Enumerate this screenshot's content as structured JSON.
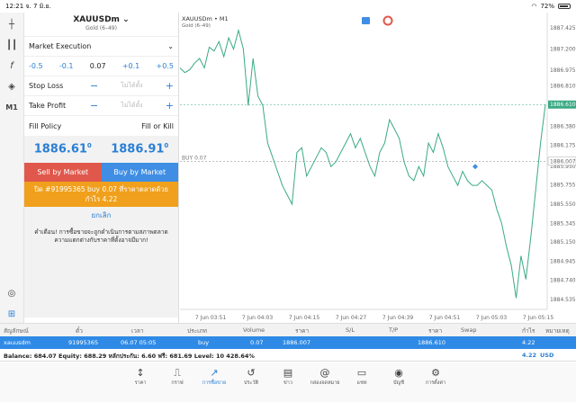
{
  "status": {
    "time": "12:21",
    "date": "จ. 7 มิ.ย.",
    "battery": "72%"
  },
  "panel": {
    "symbol": "XAUUSDm",
    "symbol_desc": "Gold (6–49)",
    "execution": "Market Execution",
    "vol_steps": [
      "-0.5",
      "-0.1",
      "0.07",
      "+0.1",
      "+0.5"
    ],
    "stop_loss": "Stop Loss",
    "take_profit": "Take Profit",
    "not_set": "ไม่ได้ตั้ง",
    "fill_policy": "Fill Policy",
    "fill_value": "Fill or Kill",
    "bid_main": "1886.61",
    "bid_small": "0",
    "ask_main": "1886.91",
    "ask_small": "0",
    "sell_label": "Sell by Market",
    "buy_label": "Buy by Market",
    "close_line1": "ปิด #91995365 buy 0.07 ที่ราคาตลาดด้วย",
    "close_line2": "กำไร 4.22",
    "cancel": "ยกเลิก",
    "warning": "คำเตือน! การซื้อขายจะถูกดำเนินการตามสภาพตลาด ความแตกต่างกับราคาที่ตั้งอาจมีมาก!"
  },
  "chart_header": {
    "symbol_tf": "XAUUSDm • M1",
    "desc": "Gold (6–49)",
    "buy_label": "BUY 0.07",
    "current_price": "1886.610",
    "buy_price": "1886.007"
  },
  "chart_data": {
    "type": "line",
    "y_ticks": [
      "1887.425",
      "1887.200",
      "1886.975",
      "1886.810",
      "1886.605",
      "1886.380",
      "1886.175",
      "1885.950",
      "1885.755",
      "1885.550",
      "1885.345",
      "1885.150",
      "1884.945",
      "1884.740",
      "1884.535"
    ],
    "x_ticks": [
      "7 Jun 03:51",
      "7 Jun 04:03",
      "7 Jun 04:15",
      "7 Jun 04:27",
      "7 Jun 04:39",
      "7 Jun 04:51",
      "7 Jun 05:03",
      "7 Jun 05:15"
    ],
    "ylim": [
      1884.45,
      1887.55
    ],
    "values": [
      1887.0,
      1886.95,
      1886.98,
      1887.05,
      1887.1,
      1887.0,
      1887.22,
      1887.18,
      1887.28,
      1887.12,
      1887.32,
      1887.2,
      1887.4,
      1887.2,
      1886.6,
      1887.1,
      1886.7,
      1886.6,
      1886.2,
      1886.05,
      1885.9,
      1885.75,
      1885.65,
      1885.55,
      1886.1,
      1886.15,
      1885.85,
      1885.95,
      1886.05,
      1886.15,
      1886.1,
      1885.95,
      1886.0,
      1886.1,
      1886.2,
      1886.3,
      1886.15,
      1886.25,
      1886.1,
      1885.95,
      1885.85,
      1886.1,
      1886.2,
      1886.45,
      1886.35,
      1886.25,
      1886.0,
      1885.85,
      1885.8,
      1885.95,
      1885.85,
      1886.2,
      1886.1,
      1886.3,
      1886.15,
      1885.95,
      1885.85,
      1885.75,
      1885.9,
      1885.8,
      1885.75,
      1885.75,
      1885.8,
      1885.75,
      1885.7,
      1885.5,
      1885.35,
      1885.1,
      1884.9,
      1884.55,
      1885.0,
      1884.75,
      1885.2,
      1885.7,
      1886.2,
      1886.61
    ]
  },
  "table": {
    "headers": [
      "สัญลักษณ์",
      "ตั๋ว",
      "เวลา",
      "ประเภท",
      "Volume",
      "ราคา",
      "S/L",
      "T/P",
      "ราคา",
      "Swap",
      "กำไร",
      "หมายเหตุ"
    ],
    "row": [
      "xauusdm",
      "91995365",
      "06.07 05:05",
      "buy",
      "0.07",
      "1886.007",
      "",
      "",
      "1886.610",
      "",
      "4.22",
      ""
    ]
  },
  "balance": {
    "text": "Balance: 684.07 Equity: 688.29 หลักประกัน: 6.60 ฟรี: 681.69 Level: 10 428.64%",
    "profit": "4.22",
    "currency": "USD"
  },
  "tabs": [
    {
      "label": "ราคา",
      "icon": "↕"
    },
    {
      "label": "กราฟ",
      "icon": "⎍"
    },
    {
      "label": "การซื้อขาย",
      "icon": "↗"
    },
    {
      "label": "ประวัติ",
      "icon": "↺"
    },
    {
      "label": "ข่าว",
      "icon": "▤"
    },
    {
      "label": "กล่องจดหมาย",
      "icon": "@"
    },
    {
      "label": "แชท",
      "icon": "▭"
    },
    {
      "label": "บัญชี",
      "icon": "◉"
    },
    {
      "label": "การตั้งค่า",
      "icon": "⚙"
    }
  ],
  "colors": {
    "accent": "#2a7fd4",
    "sell": "#e0584c",
    "buy": "#3f8ee4",
    "close": "#f0a01c",
    "line": "#3aaa84"
  }
}
